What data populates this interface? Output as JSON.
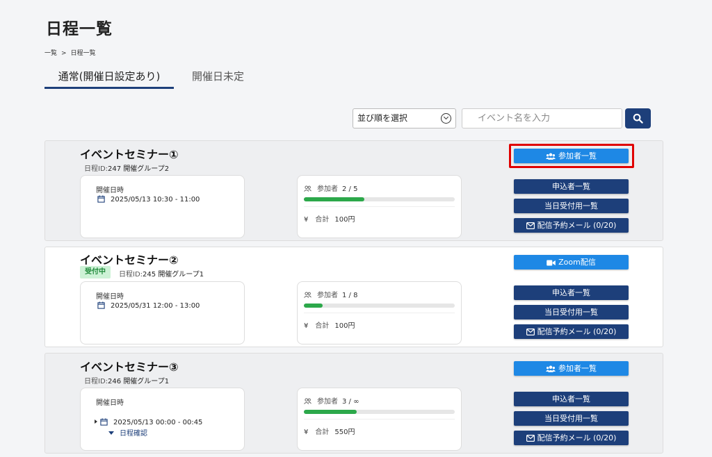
{
  "page": {
    "title": "日程一覧",
    "breadcrumb": [
      "一覧",
      ">",
      "日程一覧"
    ]
  },
  "tabs": [
    {
      "label": "通常(開催日設定あり)",
      "active": true
    },
    {
      "label": "開催日未定",
      "active": false
    }
  ],
  "filters": {
    "sort_label": "並び順を選択",
    "search_placeholder": "イベント名を入力"
  },
  "labels": {
    "date_heading": "開催日時",
    "participants": "参加者",
    "total": "合計",
    "yen": "¥",
    "id_prefix": "日程ID:"
  },
  "events": [
    {
      "title": "イベントセミナー①",
      "id": "247",
      "group": "開催グループ2",
      "badge": "",
      "datetime": "2025/05/13 10:30 - 11:00",
      "participants": "2 /  5",
      "progress": 0.4,
      "amount": "100円",
      "top_button": "参加者一覧",
      "buttons": [
        "申込者一覧",
        "当日受付用一覧",
        "配信予約メール (0/20)"
      ]
    },
    {
      "title": "イベントセミナー②",
      "id": "245",
      "group": "開催グループ1",
      "badge": "受付中",
      "datetime": "2025/05/31 12:00 - 13:00",
      "participants": "1 /  8",
      "progress": 0.125,
      "amount": "100円",
      "top_button": "Zoom配信",
      "buttons": [
        "申込者一覧",
        "当日受付用一覧",
        "配信予約メール (0/20)"
      ]
    },
    {
      "title": "イベントセミナー③",
      "id": "246",
      "group": "開催グループ1",
      "badge": "",
      "datetime": "2025/05/13 00:00 - 00:45",
      "schedule_link": "日程確認",
      "participants": "3 /  ∞",
      "progress": 0.35,
      "amount": "550円",
      "top_button": "参加者一覧",
      "buttons": [
        "申込者一覧",
        "当日受付用一覧",
        "配信予約メール (0/20)"
      ]
    }
  ],
  "colors": {
    "primary_dark": "#1d3f7a",
    "primary_light": "#1e88e5",
    "progress": "#2ca84a",
    "highlight": "#e00000"
  }
}
